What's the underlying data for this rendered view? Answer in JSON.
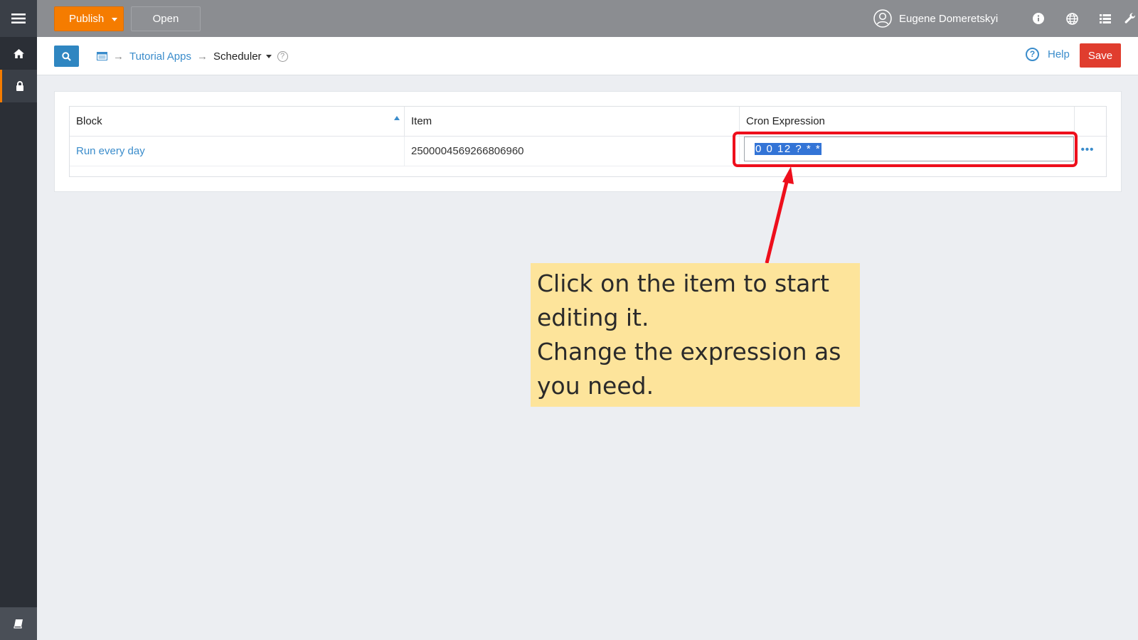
{
  "sidebar": {
    "items": [
      {
        "icon": "menu-icon"
      },
      {
        "icon": "home-icon"
      },
      {
        "icon": "lock-icon",
        "active": true
      }
    ],
    "bottom_icon": "book-icon"
  },
  "topbar": {
    "publish_label": "Publish",
    "open_label": "Open",
    "user_name": "Eugene Domeretskyi",
    "icons": [
      "info-icon",
      "globe-icon",
      "list-icon",
      "wrench-icon"
    ]
  },
  "subbar": {
    "breadcrumb": [
      "Tutorial Apps",
      "Scheduler"
    ],
    "help_label": "Help",
    "save_label": "Save"
  },
  "table": {
    "columns": [
      "Block",
      "Item",
      "Cron Expression"
    ],
    "rows": [
      {
        "block": "Run every day",
        "item": "2500004569266806960",
        "cron": "0 0 12 ? * *"
      }
    ]
  },
  "annotation": {
    "text_line1": "Click on the item to start",
    "text_line2": "editing it.",
    "text_line3": "Change the expression as",
    "text_line4": "you need."
  },
  "colors": {
    "accent": "#f57c00",
    "link": "#3a8ccb",
    "save": "#e03d2e",
    "highlight": "#ee0f1c",
    "callout": "#fde49b"
  }
}
